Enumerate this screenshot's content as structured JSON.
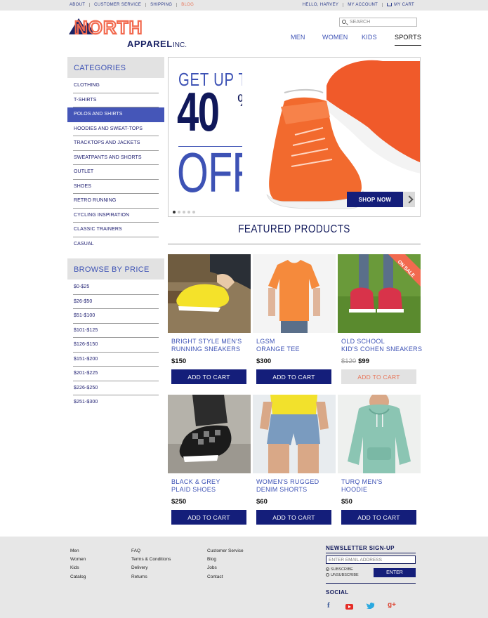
{
  "topbar": {
    "left_links": [
      "ABOUT",
      "CUSTOMER SERVICE",
      "SHIPPING",
      "BLOG"
    ],
    "greeting": "HELLO, HARVEY",
    "account": "MY ACCOUNT",
    "cart": "MY CART"
  },
  "brand": {
    "name_top": "NORTH",
    "name_bottom": "APPAREL",
    "suffix": "INC."
  },
  "search": {
    "placeholder": "SEARCH"
  },
  "nav": [
    "MEN",
    "WOMEN",
    "KIDS",
    "SPORTS"
  ],
  "categories": {
    "heading": "CATEGORIES",
    "items": [
      "CLOTHING",
      "T-SHIRTS",
      "POLOS AND SHIRTS",
      "HOODIES AND SWEAT-TOPS",
      "TRACKTOPS AND JACKETS",
      "SWEATPANTS AND SHORTS",
      "OUTLET",
      "SHOES",
      "RETRO RUNNING",
      "CYCLING INSPIRATION",
      "CLASSIC TRAINERS",
      "CASUAL"
    ],
    "active_index": 2
  },
  "price_filter": {
    "heading": "BROWSE BY PRICE",
    "items": [
      "$0-$25",
      "$26-$50",
      "$51-$100",
      "$101-$125",
      "$126-$150",
      "$151-$200",
      "$201-$225",
      "$226-$250",
      "$251-$300"
    ]
  },
  "hero": {
    "line1": "GET UP TO",
    "line2": "40",
    "percent": "%",
    "line3": "OFF",
    "cta": "SHOP NOW",
    "slide_count": 5,
    "active_slide": 1
  },
  "featured": {
    "title": "FEATURED PRODUCTS"
  },
  "products": [
    {
      "name1": "BRIGHT STYLE MEN'S",
      "name2": "RUNNING SNEAKERS",
      "price": "$150",
      "old_price": "",
      "button": "ADD TO CART",
      "on_sale": ""
    },
    {
      "name1": "LGSM",
      "name2": "ORANGE TEE",
      "price": "$300",
      "old_price": "",
      "button": "ADD TO CART",
      "on_sale": ""
    },
    {
      "name1": "OLD SCHOOL",
      "name2": "KID'S COHEN SNEAKERS",
      "price": "$99",
      "old_price": "$120",
      "button": "ADD TO CART",
      "on_sale": "ON SALE"
    },
    {
      "name1": "BLACK & GREY",
      "name2": "PLAID SHOES",
      "price": "$250",
      "old_price": "",
      "button": "ADD TO CART",
      "on_sale": ""
    },
    {
      "name1": "WOMEN'S RUGGED",
      "name2": "DENIM SHORTS",
      "price": "$60",
      "old_price": "",
      "button": "ADD TO CART",
      "on_sale": ""
    },
    {
      "name1": "TURQ MEN'S",
      "name2": "HOODIE",
      "price": "$50",
      "old_price": "",
      "button": "ADD TO CART",
      "on_sale": ""
    }
  ],
  "footer": {
    "col1": [
      "Men",
      "Women",
      "Kids",
      "Catalog"
    ],
    "col2": [
      "FAQ",
      "Terms & Conditions",
      "Delivery",
      "Returns"
    ],
    "col3": [
      "Customer Service",
      "Blog",
      "Jobs",
      "Contact"
    ],
    "newsletter": {
      "heading": "NEWSLETTER SIGN-UP",
      "placeholder": "ENTER EMAIL ADDRESS",
      "subscribe": "SUBSCRIBE",
      "unsubscribe": "UNSUBSCRIBE",
      "button": "ENTER"
    },
    "social": {
      "heading": "SOCIAL",
      "icons": [
        "facebook-icon",
        "youtube-icon",
        "twitter-icon",
        "googleplus-icon"
      ]
    }
  },
  "colors": {
    "primary": "#141e7a",
    "accent": "#3d52b5",
    "brand_orange": "#f26a4f",
    "sale": "#e8765a"
  }
}
